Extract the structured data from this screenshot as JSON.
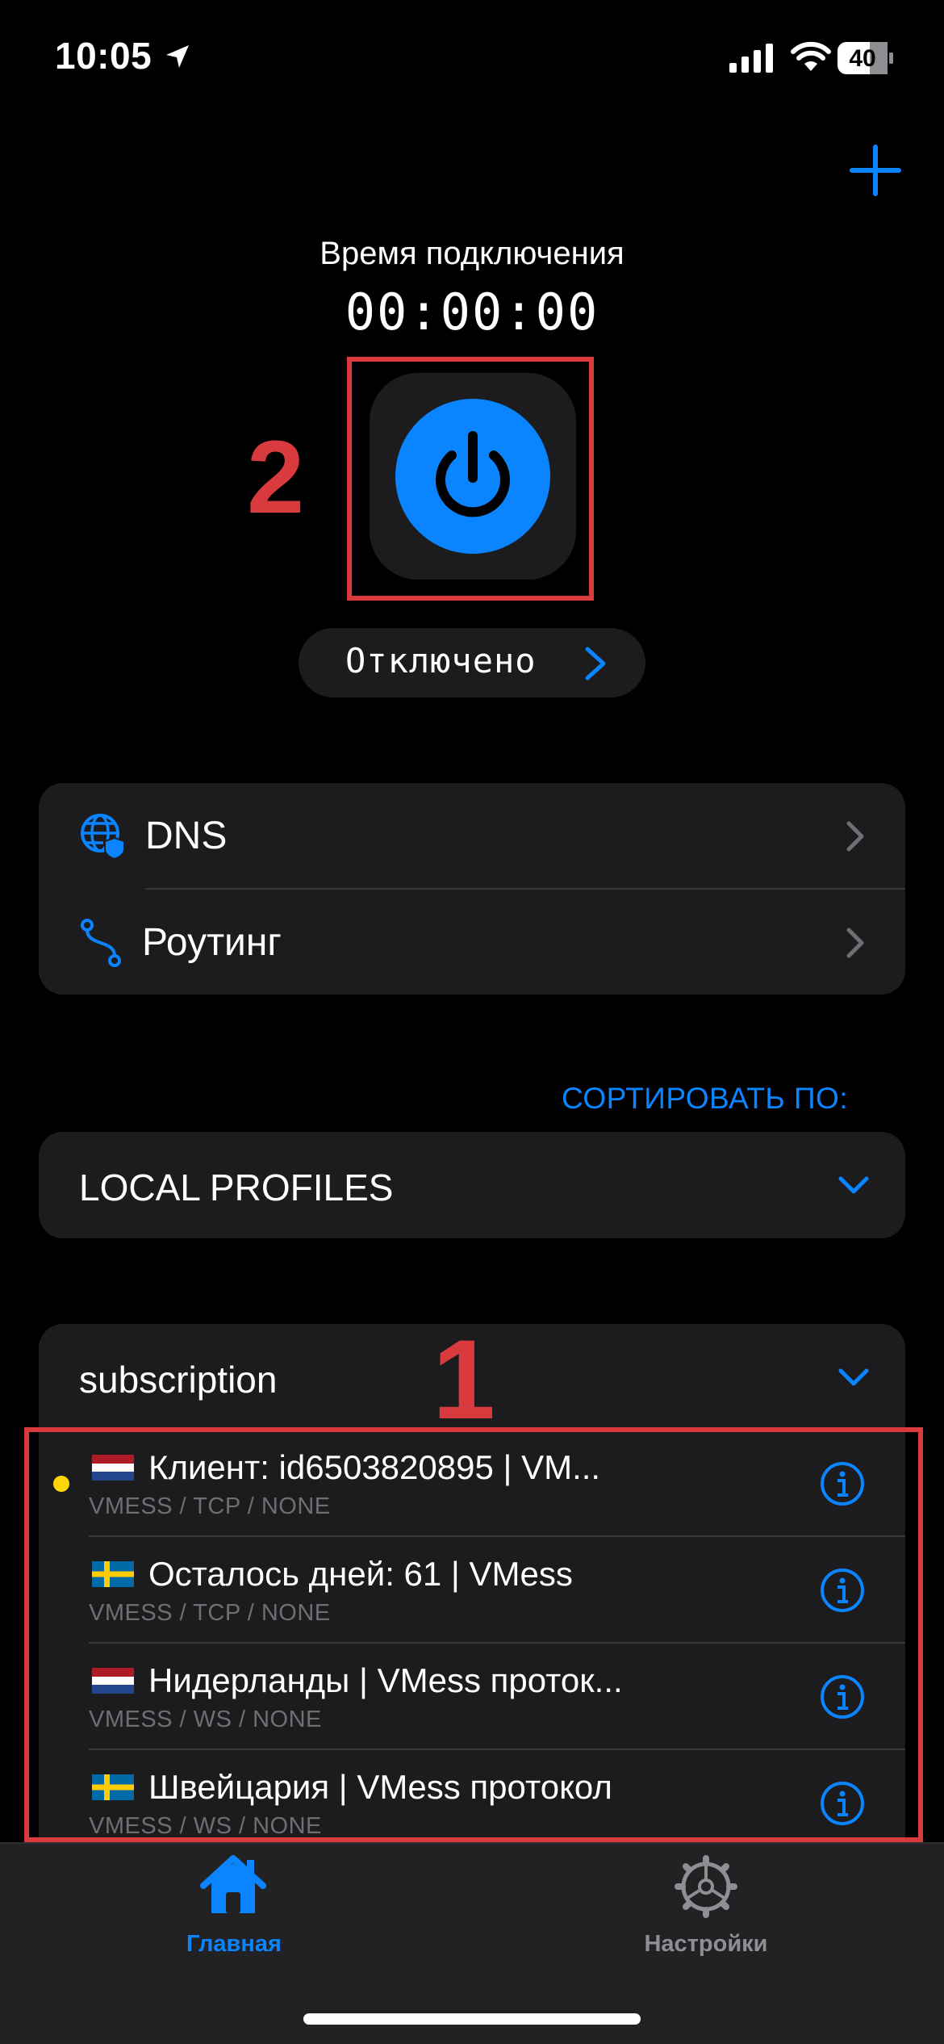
{
  "status_bar": {
    "time": "10:05",
    "battery": "40"
  },
  "header": {
    "connection_time_label": "Время подключения",
    "connection_timer": "00:00:00",
    "add_icon": "plus-icon"
  },
  "annotations": {
    "power_number": "2",
    "list_number": "1",
    "color": "#d93a3e"
  },
  "power": {
    "icon": "power-icon",
    "color": "#0a84ff",
    "status_label": "Отключено"
  },
  "settings": {
    "items": [
      {
        "label": "DNS",
        "icon": "globe-shield-icon"
      },
      {
        "label": "Роутинг",
        "icon": "routing-icon"
      }
    ]
  },
  "sort": {
    "label": "СОРТИРОВАТЬ ПО:"
  },
  "groups": [
    {
      "title": "LOCAL PROFILES"
    },
    {
      "title": "subscription"
    }
  ],
  "servers": [
    {
      "flag": "netherlands-flag",
      "title": "Клиент: id6503820895 | VM...",
      "subtitle": "VMESS / TCP / NONE",
      "active": true
    },
    {
      "flag": "sweden-flag",
      "title": "Осталось дней: 61 | VMess",
      "subtitle": "VMESS / TCP / NONE",
      "active": false
    },
    {
      "flag": "netherlands-flag",
      "title": "Нидерланды | VMess проток...",
      "subtitle": "VMESS / WS / NONE",
      "active": false
    },
    {
      "flag": "sweden-flag",
      "title": "Швейцария | VMess протокол",
      "subtitle": "VMESS / WS / NONE",
      "active": false
    }
  ],
  "tabbar": {
    "tabs": [
      {
        "label": "Главная",
        "icon": "house-icon",
        "active": true
      },
      {
        "label": "Настройки",
        "icon": "gear-icon",
        "active": false
      }
    ]
  },
  "colors": {
    "accent": "#0a84ff",
    "background": "#000000",
    "card": "#1c1c1e",
    "active_dot": "#ffd60a"
  }
}
